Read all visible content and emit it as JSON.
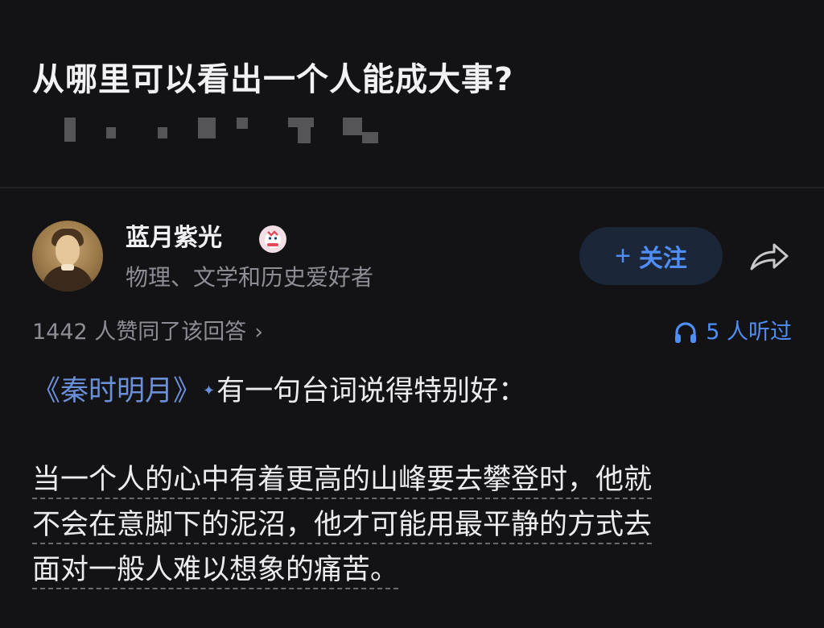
{
  "question": {
    "title": "从哪里可以看出一个人能成大事?"
  },
  "author": {
    "name": "蓝月紫光",
    "bio": "物理、文学和历史爱好者",
    "follow_label": "关注",
    "follow_plus": "+",
    "badge_icon": "mascot-badge-icon",
    "share_icon": "share-arrow-icon"
  },
  "meta": {
    "upvotes": "1442 人赞同了该回答",
    "upvotes_chevron": "›",
    "listened": "5 人听过",
    "listened_icon": "headphones-icon"
  },
  "answer": {
    "book_title": "《秦时明月》",
    "spark": "✦",
    "intro": "有一句台词说得特别好：",
    "quote_lines": [
      "当一个人的心中有着更高的山峰要去攀登时，他就",
      "不会在意脚下的泥沼，他才可能用最平静的方式去",
      "面对一般人难以想象的痛苦。"
    ]
  },
  "colors": {
    "background": "#131316",
    "accent": "#4f8ef7",
    "link": "#6b8fd8",
    "muted": "#8d8d95",
    "follow_bg": "#1b2638"
  }
}
